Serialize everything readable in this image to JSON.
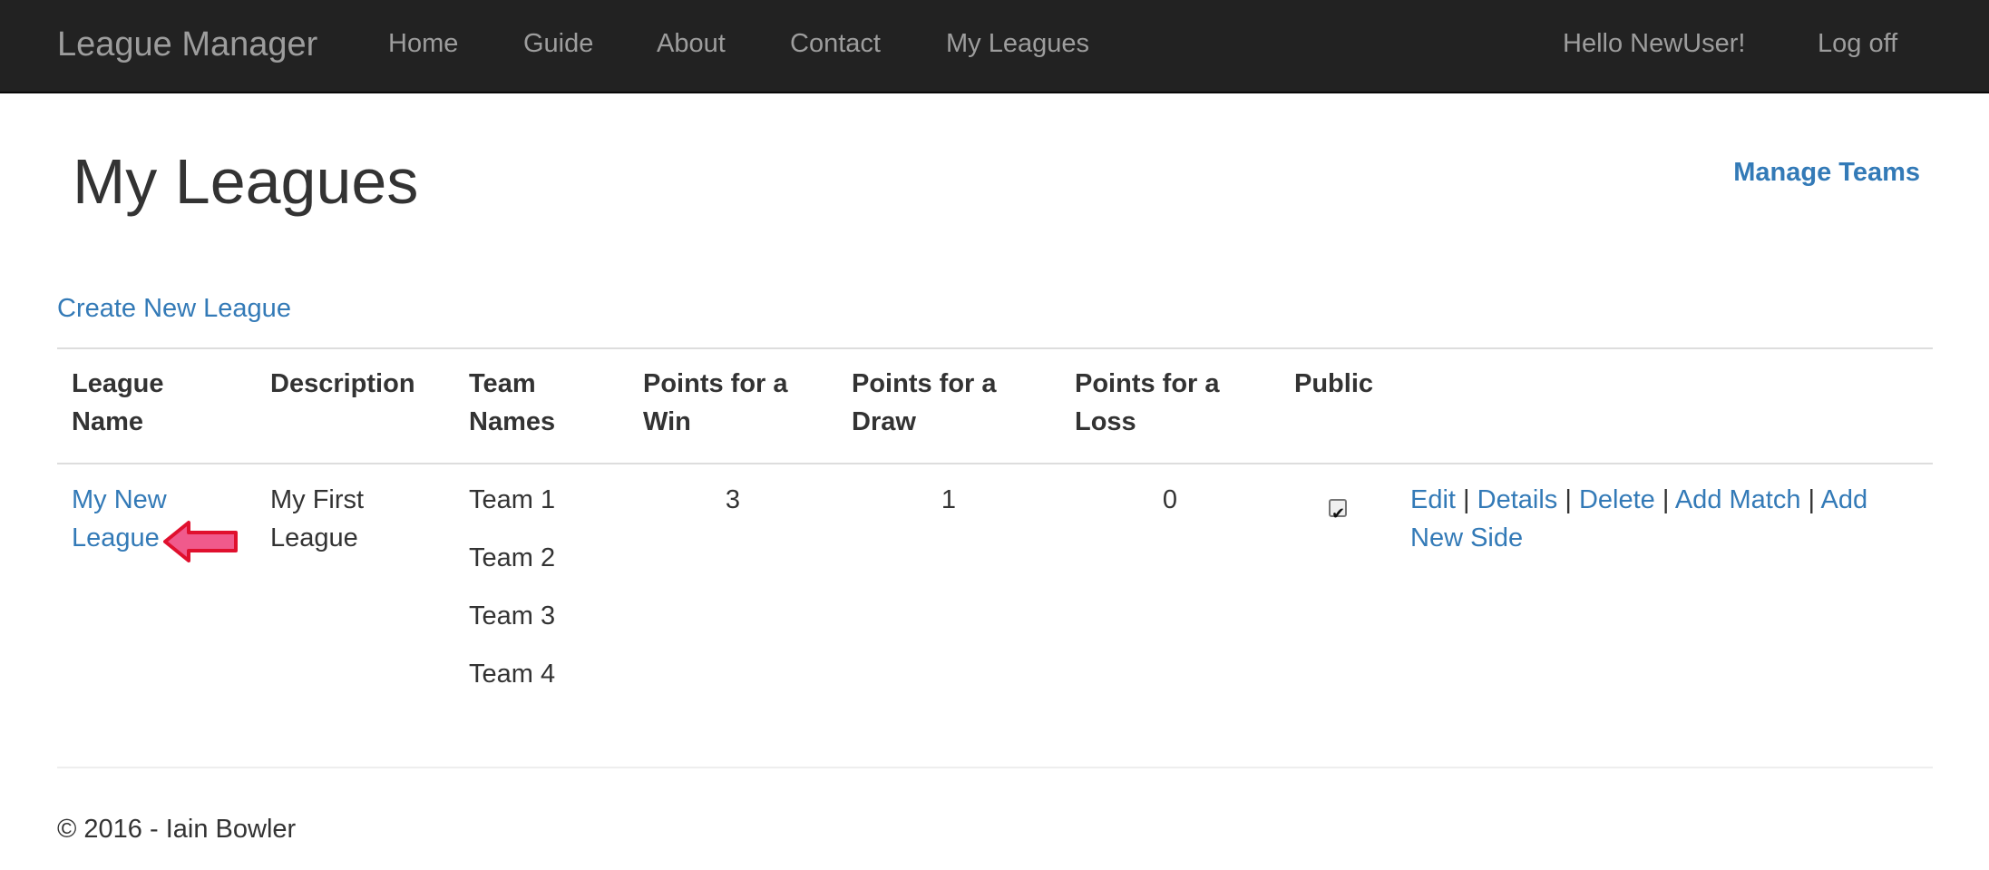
{
  "navbar": {
    "brand": "League Manager",
    "links": [
      "Home",
      "Guide",
      "About",
      "Contact",
      "My Leagues"
    ],
    "greeting": "Hello NewUser!",
    "logoff": "Log off"
  },
  "page": {
    "title": "My Leagues",
    "manage_teams": "Manage Teams",
    "create_new": "Create New League"
  },
  "table": {
    "headers": [
      "League Name",
      "Description",
      "Team Names",
      "Points for a Win",
      "Points for a Draw",
      "Points for a Loss",
      "Public"
    ],
    "rows": [
      {
        "name": "My New League",
        "description": "My First League",
        "teams": [
          "Team 1",
          "Team 2",
          "Team 3",
          "Team 4"
        ],
        "win": "3",
        "draw": "1",
        "loss": "0",
        "public": true,
        "actions": [
          "Edit",
          "Details",
          "Delete",
          "Add Match",
          "Add New Side"
        ],
        "separator": "|"
      }
    ]
  },
  "annotation": {
    "arrow_color": "#e8306a",
    "icon": "left-arrow-icon"
  },
  "footer": {
    "text": "© 2016 - Iain Bowler"
  }
}
